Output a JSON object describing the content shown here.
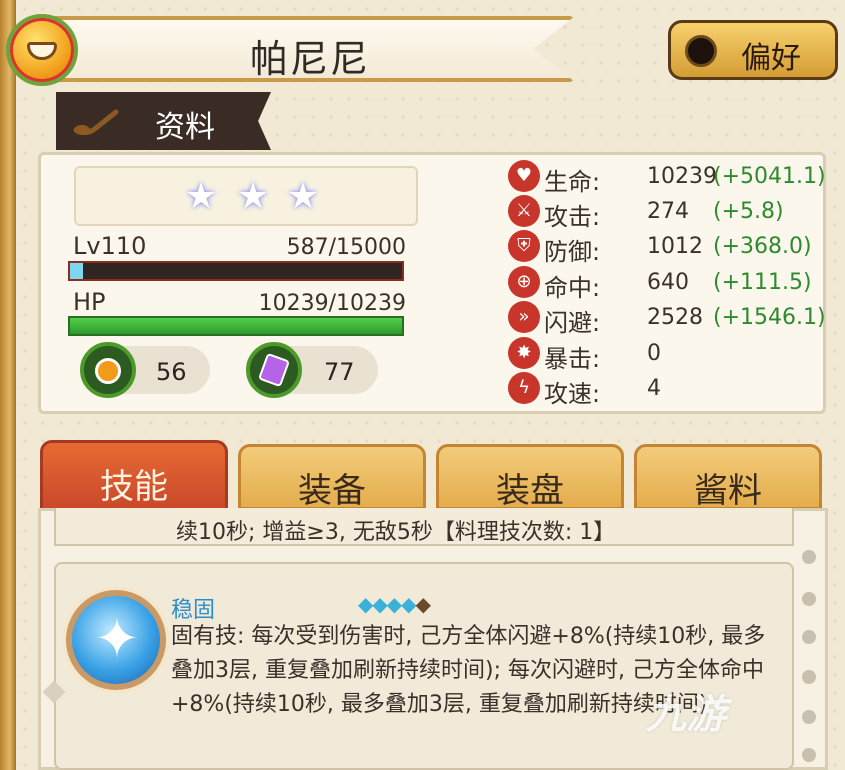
{
  "header": {
    "title": "帕尼尼",
    "preference_label": "偏好"
  },
  "info_tab": {
    "label": "资料"
  },
  "stars": {
    "count": 3
  },
  "level": {
    "label": "Lv110",
    "value": "587/15000",
    "progress": 0.039
  },
  "hp": {
    "label": "HP",
    "value": "10239/10239",
    "progress": 1.0
  },
  "resources": [
    {
      "icon": "potion-icon",
      "value": "56"
    },
    {
      "icon": "crystal-icon",
      "value": "77"
    }
  ],
  "stats": [
    {
      "icon": "heart-icon",
      "name": "生命:",
      "value": "10239",
      "bonus": "(+5041.1)"
    },
    {
      "icon": "sword-icon",
      "name": "攻击:",
      "value": "274",
      "bonus": "(+5.8)"
    },
    {
      "icon": "shield-icon",
      "name": "防御:",
      "value": "1012",
      "bonus": "(+368.0)"
    },
    {
      "icon": "target-icon",
      "name": "命中:",
      "value": "640",
      "bonus": "(+111.5)"
    },
    {
      "icon": "dodge-icon",
      "name": "闪避:",
      "value": "2528",
      "bonus": "(+1546.1)"
    },
    {
      "icon": "critical-icon",
      "name": "暴击:",
      "value": "0",
      "bonus": ""
    },
    {
      "icon": "lightning-icon",
      "name": "攻速:",
      "value": "4",
      "bonus": ""
    }
  ],
  "tabs": [
    {
      "label": "技能",
      "active": true
    },
    {
      "label": "装备",
      "active": false
    },
    {
      "label": "装盘",
      "active": false
    },
    {
      "label": "酱料",
      "active": false
    }
  ],
  "previous_skill_text": "续10秒; 增益≥3, 无敌5秒【料理技次数: 1】",
  "skill": {
    "name": "稳固",
    "gems_filled": 4,
    "gems_total": 5,
    "description": "固有技: 每次受到伤害时, 己方全体闪避+8%(持续10秒, 最多叠加3层, 重复叠加刷新持续时间); 每次闪避时, 己方全体命中+8%(持续10秒, 最多叠加3层, 重复叠加刷新持续时间)"
  },
  "watermark": "九游",
  "colors": {
    "accent": "#c9482a",
    "bonus_green": "#2e8a2e",
    "skill_name": "#2b8ec9",
    "hp_bar": "#3cb43c",
    "xp_bar": "#7fd6f0"
  }
}
